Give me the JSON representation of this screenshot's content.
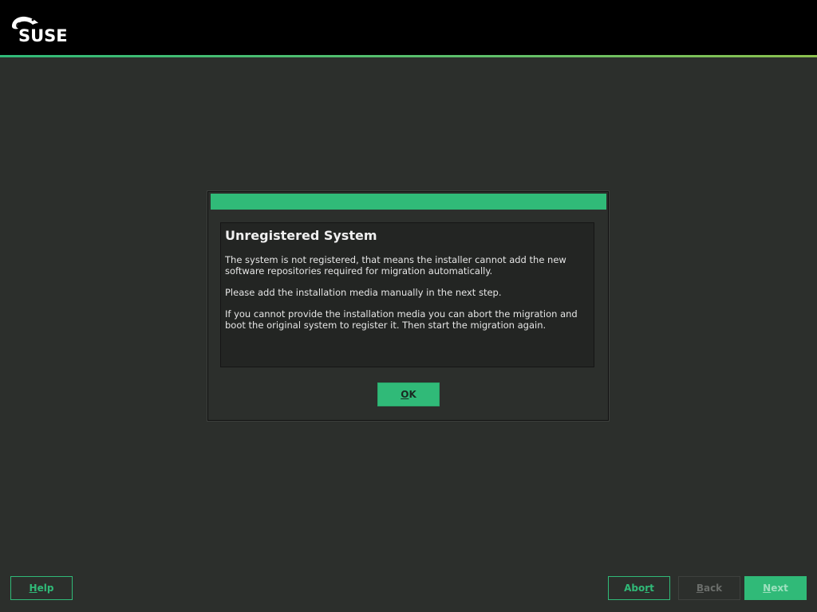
{
  "brand": {
    "logo_text": "SUSE",
    "accent_color": "#30ba78"
  },
  "dialog": {
    "heading": "Unregistered System",
    "paragraphs": [
      "The system is not registered, that means the installer cannot add the new software repositories required for migration automatically.",
      "Please add the installation media manually in the next step.",
      "If you cannot provide the installation media you can abort the migration and boot the original system to register it. Then start the migration again."
    ],
    "ok_button": {
      "accel": "O",
      "rest": "K"
    }
  },
  "footer": {
    "help": {
      "accel": "H",
      "rest": "elp"
    },
    "abort": {
      "pre": "Abo",
      "accel": "r",
      "rest": "t"
    },
    "back": {
      "accel": "B",
      "rest": "ack"
    },
    "next": {
      "accel": "N",
      "rest": "ext"
    }
  }
}
